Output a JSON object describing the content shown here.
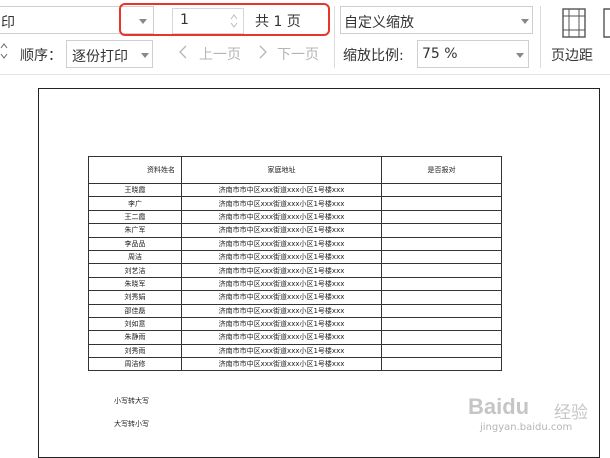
{
  "toolbar": {
    "printer_label": "印",
    "order_label": "顺序：",
    "order_value": "逐份打印",
    "page_input": "1",
    "page_total": "共 1 页",
    "prev_page": "上一页",
    "next_page": "下一页",
    "zoom_mode": "自定义缩放",
    "zoom_ratio_label": "缩放比例:",
    "zoom_ratio_value": "75 %",
    "margin_label": "页边距"
  },
  "sheet": {
    "headers": [
      "资料姓名",
      "家庭地址",
      "是否报对"
    ],
    "rows": [
      [
        "王晓霞",
        "济南市市中区xxx街道xxx小区1号楼xxx"
      ],
      [
        "李广",
        "济南市市中区xxx街道xxx小区1号楼xxx"
      ],
      [
        "王二霞",
        "济南市市中区xxx街道xxx小区1号楼xxx"
      ],
      [
        "朱广军",
        "济南市市中区xxx街道xxx小区1号楼xxx"
      ],
      [
        "李品品",
        "济南市市中区xxx街道xxx小区1号楼xxx"
      ],
      [
        "周洁",
        "济南市市中区xxx街道xxx小区1号楼xxx"
      ],
      [
        "刘艺洁",
        "济南市市中区xxx街道xxx小区1号楼xxx"
      ],
      [
        "朱晓军",
        "济南市市中区xxx街道xxx小区1号楼xxx"
      ],
      [
        "刘秀娟",
        "济南市市中区xxx街道xxx小区1号楼xxx"
      ],
      [
        "邵佳磊",
        "济南市市中区xxx街道xxx小区1号楼xxx"
      ],
      [
        "刘如意",
        "济南市市中区xxx街道xxx小区1号楼xxx"
      ],
      [
        "朱静雨",
        "济南市市中区xxx街道xxx小区1号楼xxx"
      ],
      [
        "刘秀雨",
        "济南市市中区xxx街道xxx小区1号楼xxx"
      ],
      [
        "周洁修",
        "济南市市中区xxx街道xxx小区1号楼xxx"
      ]
    ]
  },
  "notes": {
    "small_to_big": "小写转大写",
    "big_to_small": "大写转小写"
  },
  "watermark": {
    "brand": "Baidu",
    "brand_cn": "经验",
    "url": "jingyan.baidu.com"
  },
  "colors": {
    "highlight": "#e8342b",
    "toolbar_text": "#333333",
    "disabled_text": "#b5b5b5"
  }
}
